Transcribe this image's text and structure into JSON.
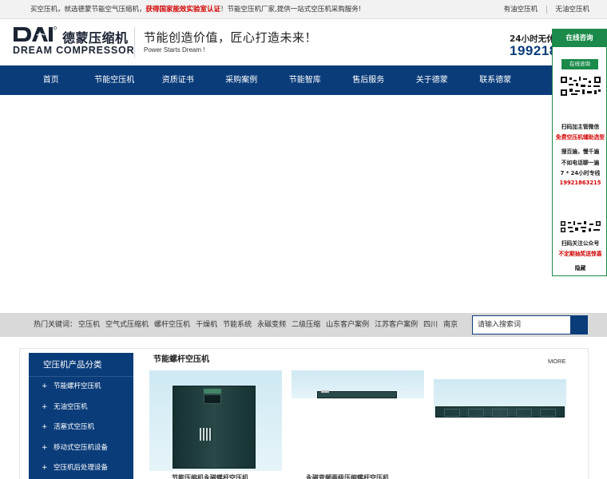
{
  "topbar": {
    "slogan_left": "买空压机，就选德蒙节能空气压缩机，",
    "slogan_highlight": "获得国家能效实验室认证",
    "slogan_right": "！节能空压机厂家,提供一站式空压机采购服务!",
    "links": [
      "有油空压机",
      "无油空压机"
    ]
  },
  "header": {
    "logo_cn": "德蒙压缩机",
    "logo_en": "DREAM COMPRESSOR",
    "tagline": "节能创造价值，匠心打造未来！",
    "tagline_en": "Power Starts Dream !",
    "hotline_label": "24小时无休专",
    "hotline_number": "199218"
  },
  "nav": {
    "items": [
      "首页",
      "节能空压机",
      "资质证书",
      "采购案例",
      "节能智库",
      "售后服务",
      "关于德蒙",
      "联系德蒙"
    ]
  },
  "hot_keywords": {
    "label": "热门关键词：",
    "items": [
      "空压机",
      "空气式压缩机",
      "螺杆空压机",
      "干燥机",
      "节能系统",
      "永磁变频",
      "二级压缩",
      "山东客户案例",
      "江苏客户案例",
      "四川",
      "南京"
    ]
  },
  "search": {
    "placeholder": "请输入搜索词"
  },
  "sidebar": {
    "title": "空压机产品分类",
    "bullet": "+",
    "items": [
      "节能螺杆空压机",
      "无油空压机",
      "活塞式空压机",
      "移动式空压机设备",
      "空压机后处理设备"
    ]
  },
  "products": {
    "section_title": "节能螺杆空压机",
    "more_label": "MORE",
    "captions": [
      "节能压缩机永磁螺杆空压机",
      "永磁变频两级压缩螺杆空压机"
    ]
  },
  "consult": {
    "title": "在线咨询",
    "online_button": "在线咨询",
    "wechat_line1": "扫码加主管微信",
    "wechat_line2": "免费空压机辅助选型",
    "pitch_line1": "搜百遍，慢千遍",
    "pitch_line2": "不如电话聊一遍",
    "pitch_line3": "7 * 24小时专线",
    "phone": "19921863215",
    "public_line1": "扫码关注公众号",
    "public_line2": "不定期抽奖送惊喜",
    "hide_label": "隐藏"
  },
  "colors": {
    "nav_blue": "#0a3c7a",
    "consult_green": "#1b8a4a",
    "highlight_red": "#d20000",
    "hotbar_gray": "#d9d9d9"
  }
}
